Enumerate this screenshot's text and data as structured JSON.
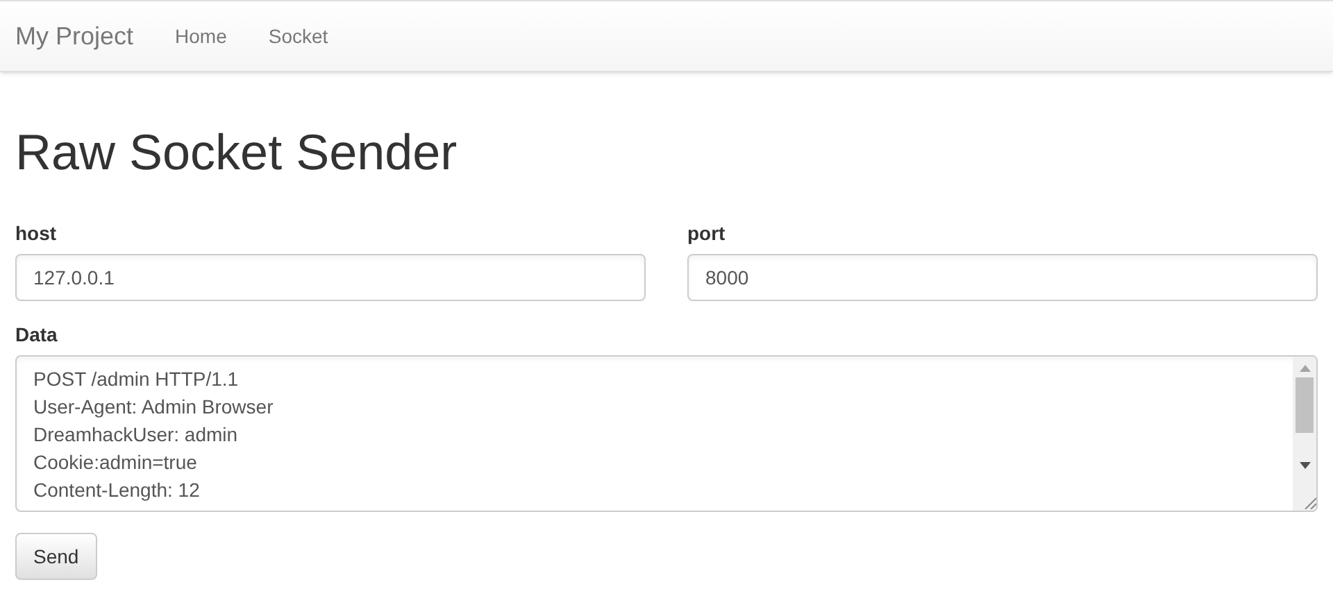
{
  "navbar": {
    "brand": "My Project",
    "links": [
      {
        "label": "Home",
        "selected": false
      },
      {
        "label": "Socket",
        "selected": false
      }
    ]
  },
  "title": "Raw Socket Sender",
  "fields": [
    {
      "label": "host",
      "value": "127.0.0.1"
    },
    {
      "label": "port",
      "value": "8000"
    }
  ],
  "data": {
    "label": "Data",
    "lines": [
      "POST /admin HTTP/1.1",
      "User-Agent: Admin Browser",
      "DreamhackUser: admin",
      "Cookie:admin=true",
      "Content-Length: 12"
    ]
  },
  "buttons": [
    "Send"
  ]
}
